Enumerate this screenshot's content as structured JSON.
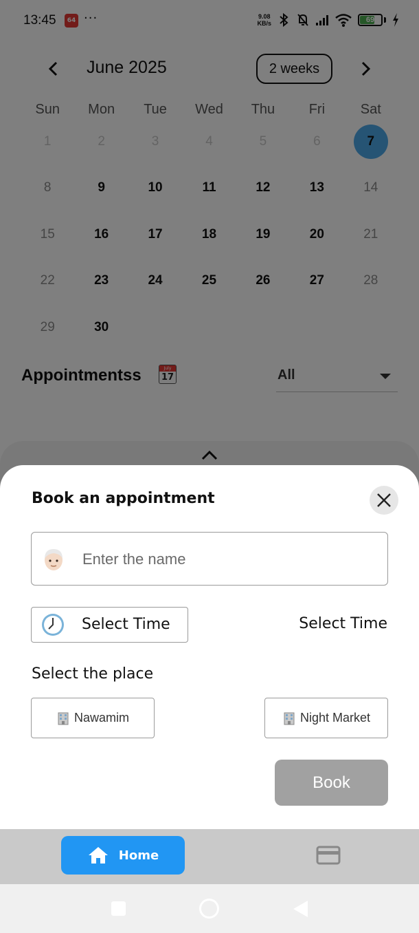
{
  "status_bar": {
    "time": "13:45",
    "app_badge": "64",
    "more": "···",
    "net_speed_value": "9.08",
    "net_speed_unit": "KB/s",
    "battery": "69",
    "battery_level": 0.69
  },
  "calendar": {
    "month_title": "June 2025",
    "format_button": "2 weeks",
    "weekdays": [
      "Sun",
      "Mon",
      "Tue",
      "Wed",
      "Thu",
      "Fri",
      "Sat"
    ],
    "days": [
      {
        "label": "1",
        "kind": "outside"
      },
      {
        "label": "2",
        "kind": "outside"
      },
      {
        "label": "3",
        "kind": "outside"
      },
      {
        "label": "4",
        "kind": "outside"
      },
      {
        "label": "5",
        "kind": "outside"
      },
      {
        "label": "6",
        "kind": "outside"
      },
      {
        "label": "7",
        "kind": "selected"
      },
      {
        "label": "8",
        "kind": "weekend"
      },
      {
        "label": "9",
        "kind": "active"
      },
      {
        "label": "10",
        "kind": "active"
      },
      {
        "label": "11",
        "kind": "active"
      },
      {
        "label": "12",
        "kind": "active"
      },
      {
        "label": "13",
        "kind": "active"
      },
      {
        "label": "14",
        "kind": "weekend"
      },
      {
        "label": "15",
        "kind": "weekend"
      },
      {
        "label": "16",
        "kind": "active"
      },
      {
        "label": "17",
        "kind": "active"
      },
      {
        "label": "18",
        "kind": "active"
      },
      {
        "label": "19",
        "kind": "active"
      },
      {
        "label": "20",
        "kind": "active"
      },
      {
        "label": "21",
        "kind": "weekend"
      },
      {
        "label": "22",
        "kind": "weekend"
      },
      {
        "label": "23",
        "kind": "active"
      },
      {
        "label": "24",
        "kind": "active"
      },
      {
        "label": "25",
        "kind": "active"
      },
      {
        "label": "26",
        "kind": "active"
      },
      {
        "label": "27",
        "kind": "active"
      },
      {
        "label": "28",
        "kind": "weekend"
      },
      {
        "label": "29",
        "kind": "weekend"
      },
      {
        "label": "30",
        "kind": "active"
      }
    ],
    "selected_color": "#4da8e8"
  },
  "appointments": {
    "title": "Appointmentss",
    "calendar_emoji_month": "July",
    "calendar_emoji_day": "17",
    "filter_value": "All"
  },
  "sheet": {
    "title": "Book an appointment",
    "name_placeholder": "Enter the name",
    "time_button": "Select Time",
    "time_value": "Select Time",
    "place_label": "Select the place",
    "places": [
      "Nawamim",
      "Night Market"
    ],
    "book_button": "Book"
  },
  "bottom_nav": {
    "home_label": "Home",
    "accent": "#2196f3"
  }
}
